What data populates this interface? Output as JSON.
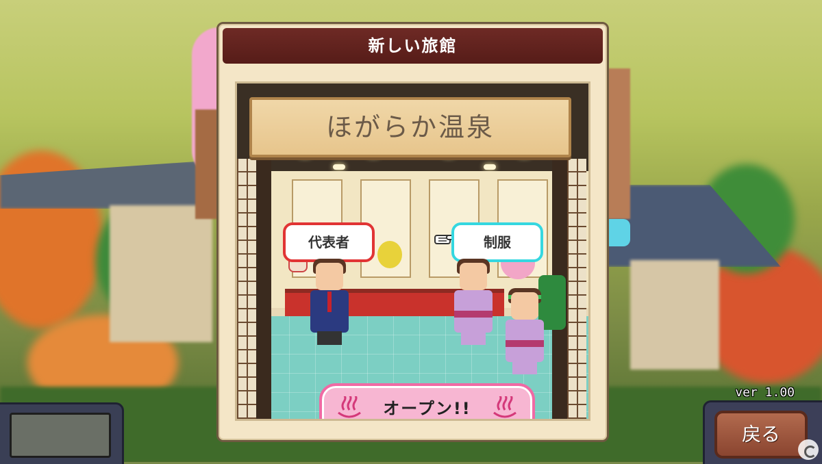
{
  "dialog": {
    "title": "新しい旅館",
    "inn_name": "ほがらか温泉",
    "representative_label": "代表者",
    "uniform_label": "制服",
    "open_label": "オープン!!"
  },
  "version": "ver 1.00",
  "back_label": "戻る",
  "colors": {
    "title_bar": "#5e221d",
    "representative_border": "#e13434",
    "uniform_border": "#35d7e0",
    "open_button": "#f7b6d2"
  },
  "icons": [
    "pointing-hand-icon",
    "onsen-icon",
    "onsen-icon",
    "gamer-watermark-icon"
  ]
}
